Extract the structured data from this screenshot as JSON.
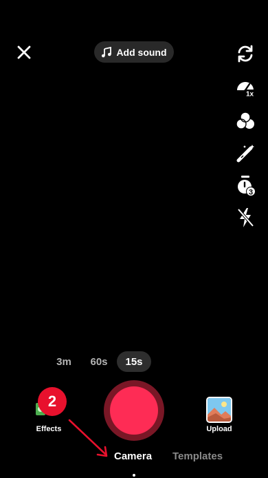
{
  "top_bar": {
    "close_icon": "close-icon",
    "add_sound_label": "Add sound",
    "music_icon": "music-note-icon"
  },
  "right_rail": [
    {
      "name": "flip-camera-icon"
    },
    {
      "name": "speed-icon",
      "caption": "1x"
    },
    {
      "name": "filters-icon"
    },
    {
      "name": "beautify-icon"
    },
    {
      "name": "timer-icon",
      "caption": "3"
    },
    {
      "name": "flash-off-icon"
    }
  ],
  "durations": {
    "options": [
      "3m",
      "60s",
      "15s"
    ],
    "selected": "15s"
  },
  "effects": {
    "label": "Effects",
    "icon": "effects-icon"
  },
  "upload": {
    "label": "Upload",
    "icon": "gallery-thumbnail"
  },
  "annotation": {
    "badge_number": "2",
    "badge_color": "#e8112d"
  },
  "record_button": {
    "color": "#fe2c55"
  },
  "modes": {
    "tabs": [
      "Camera",
      "Templates"
    ],
    "active": "Camera"
  }
}
